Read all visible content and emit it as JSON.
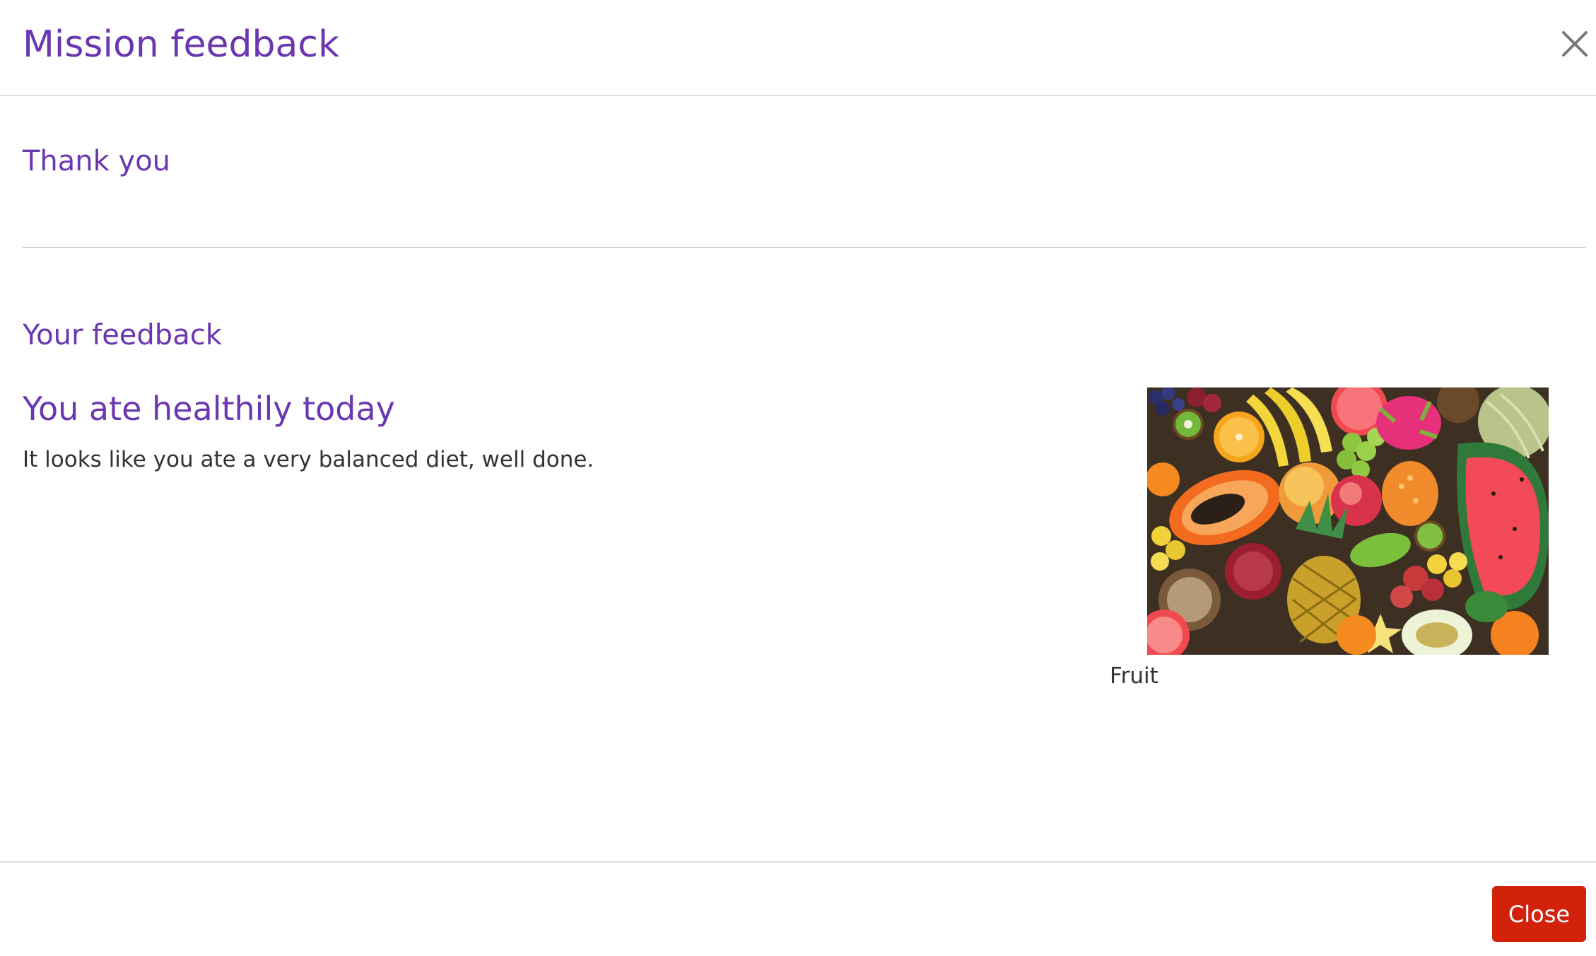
{
  "modal": {
    "title": "Mission feedback",
    "close_icon": "close-icon"
  },
  "sections": {
    "thank_you": "Thank you",
    "your_feedback": "Your feedback"
  },
  "feedback": {
    "title": "You ate healthily today",
    "text": "It looks like you ate a very balanced diet, well done.",
    "image_caption": "Fruit"
  },
  "footer": {
    "close_label": "Close"
  },
  "colors": {
    "accent": "#6a37b0",
    "button": "#d2220c",
    "text": "#333333"
  }
}
